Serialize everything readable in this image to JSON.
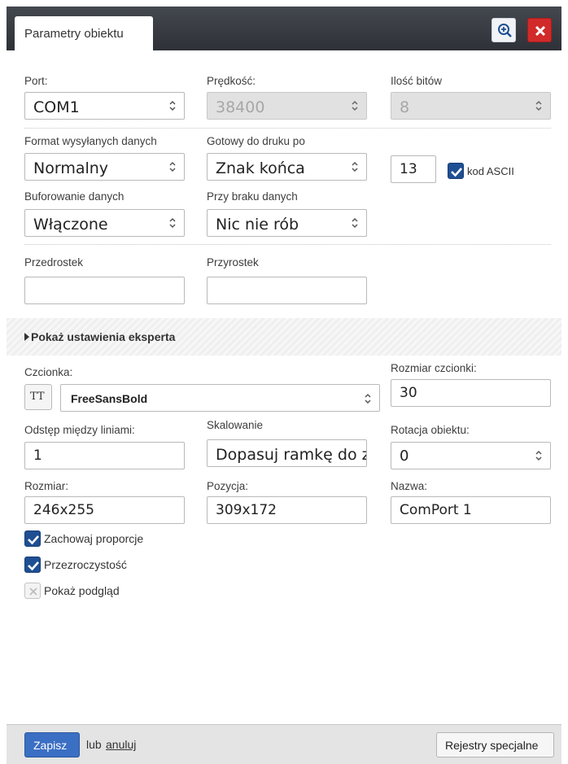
{
  "header": {
    "tab_label": "Parametry obiektu",
    "zoom_icon": "zoom-in-icon",
    "close_icon": "close-icon",
    "close_color": "#d12a2a"
  },
  "serial": {
    "port_label": "Port:",
    "port_value": "COM1",
    "speed_label": "Prędkość:",
    "speed_value": "38400",
    "bits_label": "Ilość bitów",
    "bits_value": "8",
    "format_label": "Format wysyłanych danych",
    "format_value": "Normalny",
    "ready_label": "Gotowy do druku po",
    "ready_value": "Znak końca",
    "end_char_value": "13",
    "ascii_label": "kod ASCII",
    "ascii_checked": true,
    "buffer_label": "Buforowanie danych",
    "buffer_value": "Włączone",
    "nodata_label": "Przy braku danych",
    "nodata_value": "Nic nie rób",
    "prefix_label": "Przedrostek",
    "prefix_value": "",
    "suffix_label": "Przyrostek",
    "suffix_value": ""
  },
  "expert": {
    "label": "Pokaż ustawienia eksperta"
  },
  "appearance": {
    "font_label": "Czcionka:",
    "font_style_button": "TT",
    "font_value": "FreeSansBold",
    "font_size_label": "Rozmiar czcionki:",
    "font_size_value": "30",
    "line_spacing_label": "Odstęp między liniami:",
    "line_spacing_value": "1",
    "scaling_label": "Skalowanie",
    "scaling_value": "Dopasuj ramkę do z",
    "rotation_label": "Rotacja obiektu:",
    "rotation_value": "0",
    "size_label": "Rozmiar:",
    "size_value": "246x255",
    "position_label": "Pozycja:",
    "position_value": "309x172",
    "name_label": "Nazwa:",
    "name_value": "ComPort 1",
    "keep_ratio_label": "Zachowaj proporcje",
    "keep_ratio_checked": true,
    "transparency_label": "Przezroczystość",
    "transparency_checked": true,
    "preview_label": "Pokaż podgląd",
    "preview_checked": false
  },
  "footer": {
    "save_label": "Zapisz",
    "or_text": "lub",
    "cancel_label": "anuluj",
    "special_label": "Rejestry specjalne"
  },
  "colors": {
    "accent": "#3b6fc4",
    "checkbox": "#1f4f93",
    "header": "#383b41"
  }
}
